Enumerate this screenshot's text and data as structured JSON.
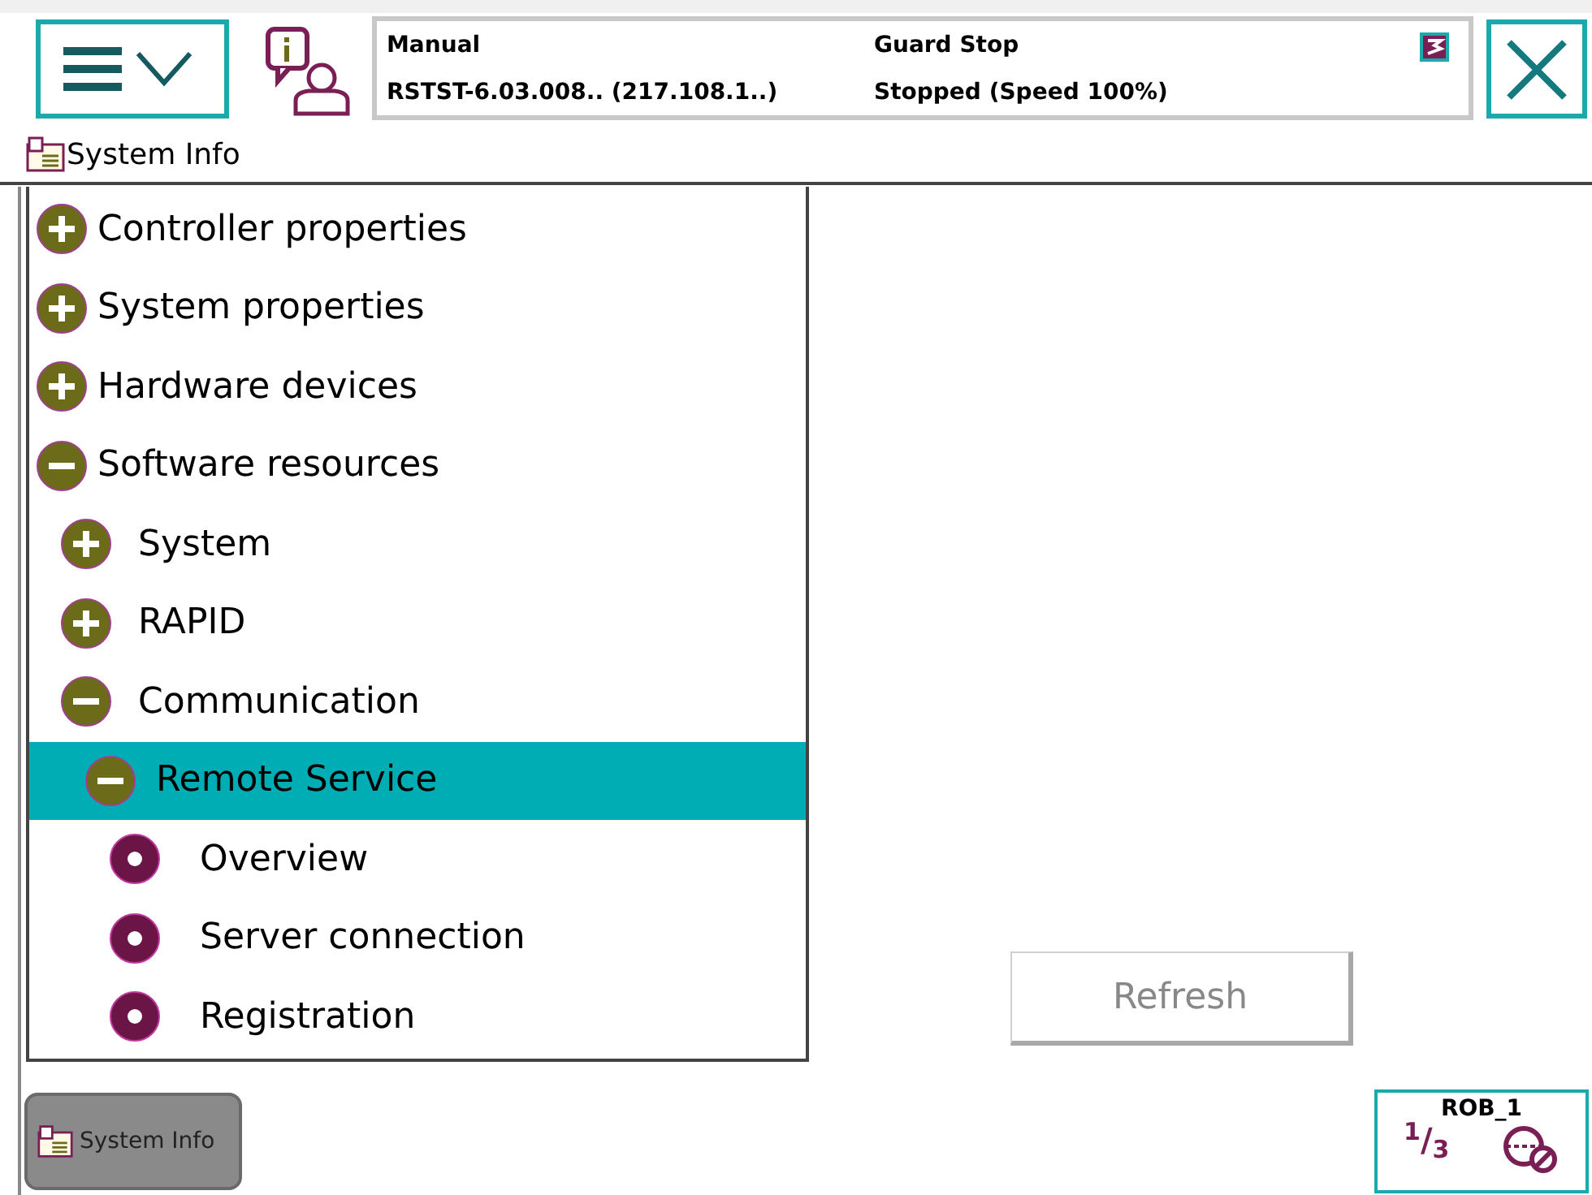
{
  "status": {
    "mode": "Manual",
    "system": "RSTST-6.03.008.. (217.108.1..)",
    "state": "Guard Stop",
    "speed": "Stopped (Speed 100%)"
  },
  "view_title": "System Info",
  "tree": [
    {
      "label": "Controller properties",
      "kind": "group",
      "expanded": false,
      "selected": false
    },
    {
      "label": "System properties",
      "kind": "group",
      "expanded": false,
      "selected": false
    },
    {
      "label": "Hardware devices",
      "kind": "group",
      "expanded": false,
      "selected": false
    },
    {
      "label": "Software resources",
      "kind": "group",
      "expanded": true,
      "selected": false,
      "children": [
        {
          "label": "System",
          "kind": "group",
          "expanded": false,
          "selected": false
        },
        {
          "label": "RAPID",
          "kind": "group",
          "expanded": false,
          "selected": false
        },
        {
          "label": "Communication",
          "kind": "group",
          "expanded": true,
          "selected": false,
          "children": [
            {
              "label": "Remote Service",
              "kind": "group",
              "expanded": true,
              "selected": true,
              "children": [
                {
                  "label": "Overview",
                  "kind": "leaf",
                  "selected": false
                },
                {
                  "label": "Server connection",
                  "kind": "leaf",
                  "selected": false
                },
                {
                  "label": "Registration",
                  "kind": "leaf",
                  "selected": false
                }
              ]
            }
          ]
        }
      ]
    }
  ],
  "refresh_button": {
    "label": "Refresh",
    "disabled": true
  },
  "taskbar": [
    {
      "label": "System Info",
      "selected": true
    }
  ],
  "quickset": {
    "unit": "ROB_1",
    "increment": "$^{1}$/$_{3}$"
  }
}
